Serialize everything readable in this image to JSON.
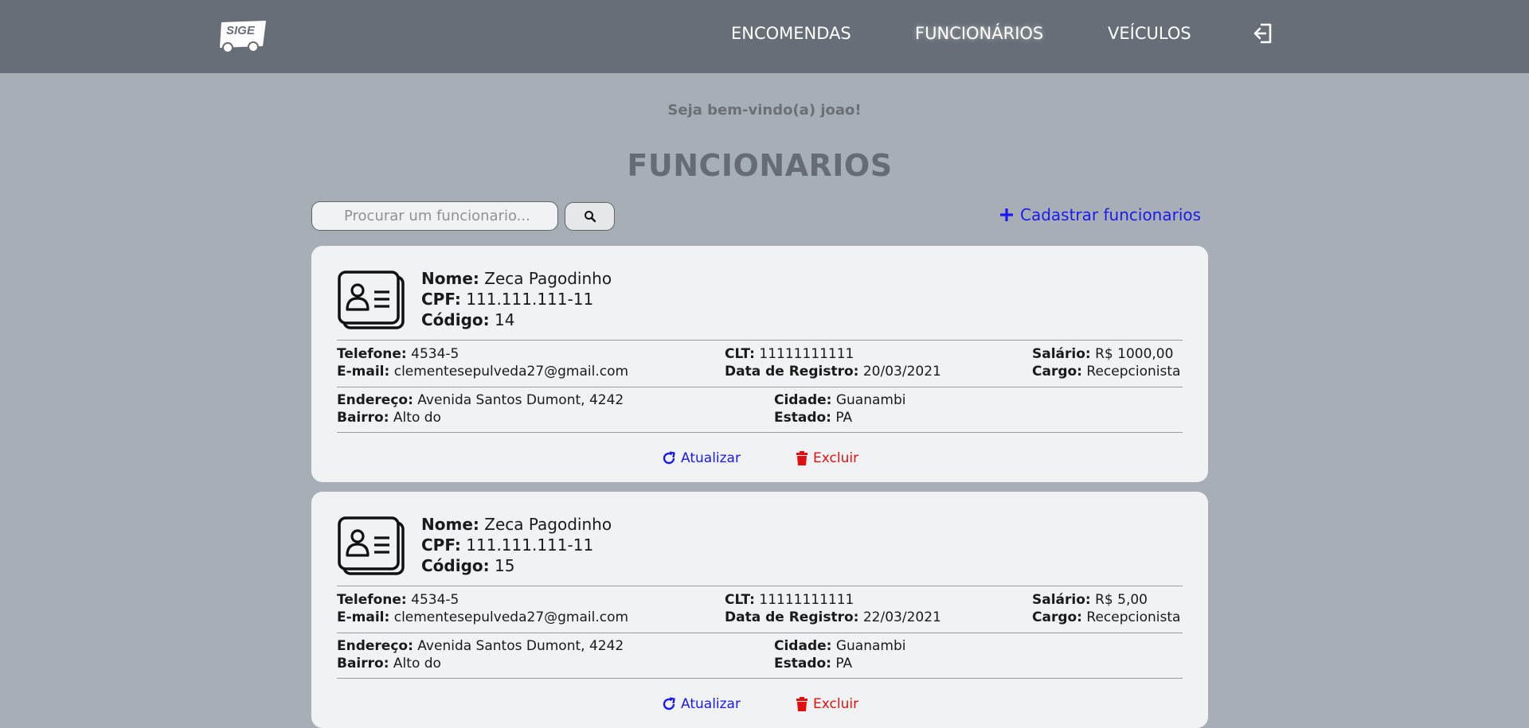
{
  "header": {
    "logo_text": "SIGE",
    "nav": [
      {
        "label": "ENCOMENDAS"
      },
      {
        "label": "FUNCIONÁRIOS"
      },
      {
        "label": "VEÍCULOS"
      }
    ]
  },
  "welcome": "Seja bem-vindo(a) joao!",
  "title": "FUNCIONARIOS",
  "search": {
    "placeholder": "Procurar um funcionario..."
  },
  "add_label": "Cadastrar funcionarios",
  "labels": {
    "nome": "Nome:",
    "cpf": "CPF:",
    "codigo": "Código:",
    "telefone": "Telefone:",
    "email": "E-mail:",
    "clt": "CLT:",
    "data_registro": "Data de Registro:",
    "salario": "Salário:",
    "cargo": "Cargo:",
    "endereco": "Endereço:",
    "bairro": "Bairro:",
    "cidade": "Cidade:",
    "estado": "Estado:",
    "atualizar": "Atualizar",
    "excluir": "Excluir"
  },
  "employees": [
    {
      "nome": "Zeca Pagodinho",
      "cpf": "111.111.111-11",
      "codigo": "14",
      "telefone": "4534-5",
      "email": "clementesepulveda27@gmail.com",
      "clt": "11111111111",
      "data_registro": "20/03/2021",
      "salario": "R$ 1000,00",
      "cargo": "Recepcionista",
      "endereco": "Avenida Santos Dumont, 4242",
      "bairro": "Alto do",
      "cidade": "Guanambi",
      "estado": "PA"
    },
    {
      "nome": "Zeca Pagodinho",
      "cpf": "111.111.111-11",
      "codigo": "15",
      "telefone": "4534-5",
      "email": "clementesepulveda27@gmail.com",
      "clt": "11111111111",
      "data_registro": "22/03/2021",
      "salario": "R$ 5,00",
      "cargo": "Recepcionista",
      "endereco": "Avenida Santos Dumont, 4242",
      "bairro": "Alto do",
      "cidade": "Guanambi",
      "estado": "PA"
    }
  ]
}
